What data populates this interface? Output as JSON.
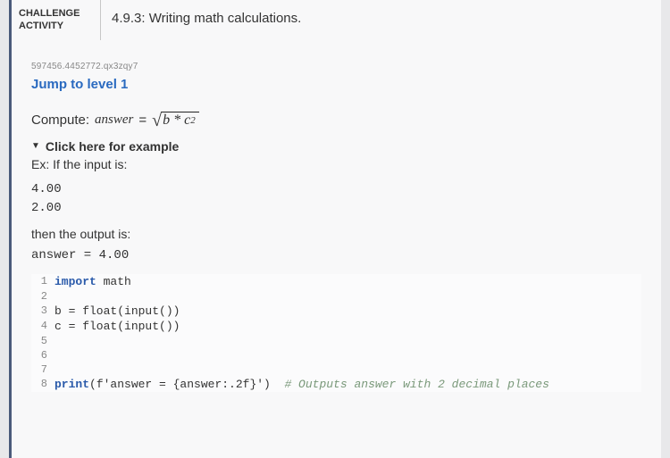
{
  "header": {
    "label_top": "CHALLENGE",
    "label_bottom": "ACTIVITY",
    "title": "4.9.3: Writing math calculations."
  },
  "idcode": "597456.4452772.qx3zqy7",
  "jump_link": "Jump to level 1",
  "compute_label": "Compute:",
  "compute_var": "answer",
  "equals": "=",
  "formula": {
    "inside": "b * c",
    "exp": "2"
  },
  "disclosure": "Click here for example",
  "ex_prefix": "Ex: If the input is:",
  "input_lines": [
    "4.00",
    "2.00"
  ],
  "then_output": "then the output is:",
  "output_line": "answer = 4.00",
  "code": {
    "l1_kw": "import",
    "l1_rest": " math",
    "l3": "b = float(input())",
    "l4": "c = float(input())",
    "l8a": "print",
    "l8b": "(f'answer = {answer:.2f}')  ",
    "l8c": "# Outputs answer with 2 decimal places"
  }
}
